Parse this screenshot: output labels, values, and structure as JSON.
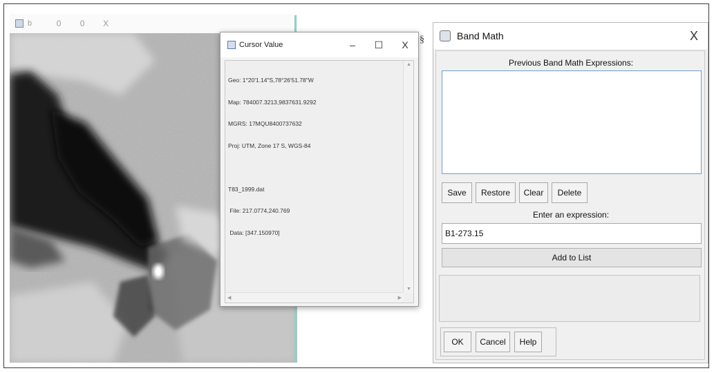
{
  "viewer": {
    "title_label": "b",
    "controls": {
      "minimize": "0",
      "maximize": "0",
      "close": "X"
    }
  },
  "cursor_value": {
    "title": "Cursor Value",
    "controls": {
      "minimize": "–",
      "maximize": "☐",
      "close": "X"
    },
    "lines": [
      "Geo: 1°20'1.14\"S,78°26'51.78\"W",
      "Map: 784007.3213,9837631.9292",
      "MGRS: 17MQU8400737632",
      "Proj: UTM, Zone 17 S, WGS-84",
      "",
      "T83_1999.dat",
      " File: 217.0774,240.769",
      " Data: [347.150970]"
    ]
  },
  "band_math": {
    "title": "Band Math",
    "close": "X",
    "previous_label": "Previous Band Math Expressions:",
    "buttons": {
      "save": "Save",
      "restore": "Restore",
      "clear": "Clear",
      "delete": "Delete"
    },
    "enter_label": "Enter an expression:",
    "expression_value": "B1-273.15",
    "add_to_list": "Add to List",
    "ok": "OK",
    "cancel": "Cancel",
    "help": "Help"
  },
  "separator_glyph": "§",
  "colors": {
    "dialog_bg": "#f0f0f0",
    "list_border": "#6e9ccf",
    "viewer_edge": "#8fd0c8"
  }
}
